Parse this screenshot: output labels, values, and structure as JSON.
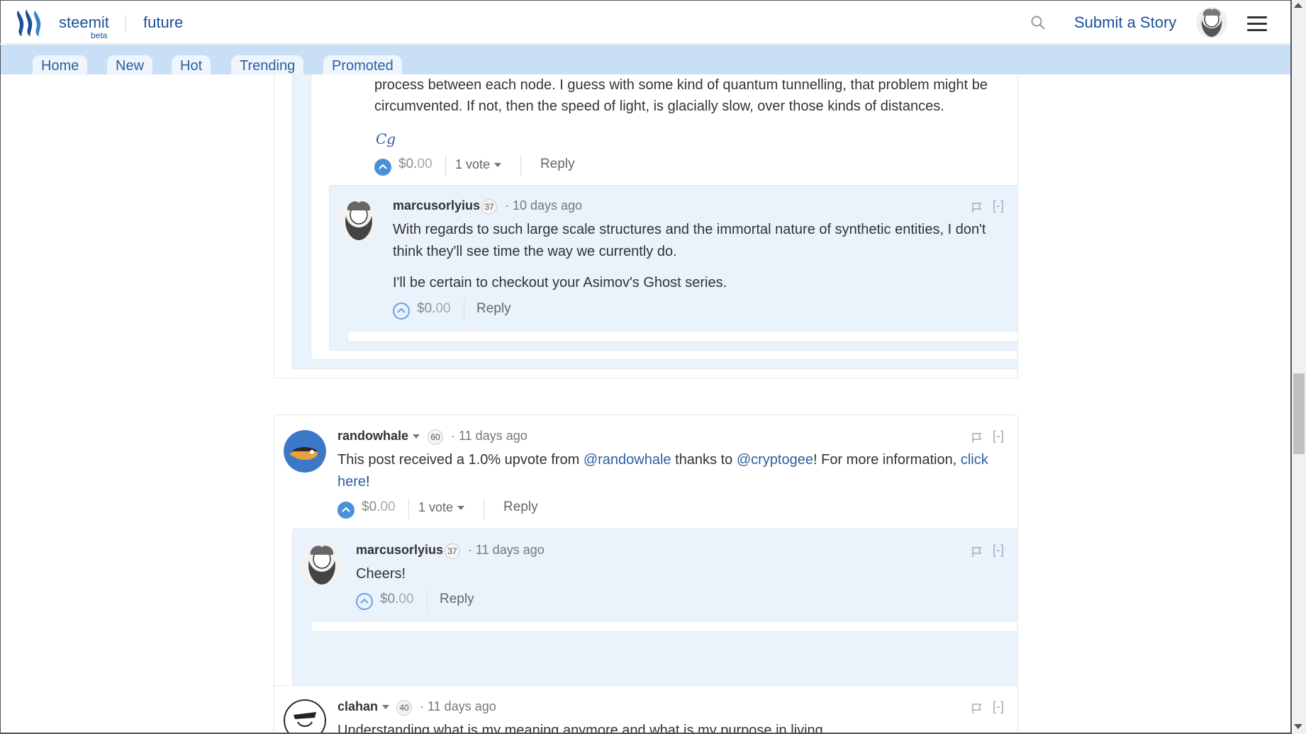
{
  "header": {
    "brand": "steemit",
    "brand_sub": "beta",
    "section": "future",
    "submit_label": "Submit a Story"
  },
  "nav": {
    "tabs": [
      "Home",
      "New",
      "Hot",
      "Trending",
      "Promoted"
    ]
  },
  "thread1": {
    "parent_text_line1": "process between each node. I guess with some kind of quantum tunnelling, that problem might be",
    "parent_text_line2": "circumvented. If not, then the speed of light, is glacially slow, over those kinds of distances.",
    "parent_signature": "Cg",
    "parent_payout_main": "$0.",
    "parent_payout_cents": "00",
    "parent_votes": "1 vote",
    "parent_reply": "Reply",
    "reply": {
      "author": "marcusorlyius",
      "rep": "37",
      "time": "· 10 days ago",
      "collapse": "[-]",
      "text_line1": "With regards to such large scale structures and the immortal nature of synthetic entities, I don't",
      "text_line2": "think they'll see time the way we currently do.",
      "text_line3": "I'll be certain to checkout your Asimov's Ghost series.",
      "payout_main": "$0.",
      "payout_cents": "00",
      "reply_label": "Reply"
    }
  },
  "thread2": {
    "author": "randowhale",
    "rep": "60",
    "time": "· 11 days ago",
    "collapse": "[-]",
    "text_a": "This post received a 1.0% upvote from ",
    "link_a": "@randowhale",
    "text_b": " thanks to ",
    "link_b": "@cryptogee",
    "text_c": "! For more information, ",
    "link_c1": "click",
    "link_c2": "here",
    "text_d": "!",
    "payout_main": "$0.",
    "payout_cents": "00",
    "votes": "1 vote",
    "reply_label": "Reply",
    "reply": {
      "author": "marcusorlyius",
      "rep": "37",
      "time": "· 11 days ago",
      "collapse": "[-]",
      "text": "Cheers!",
      "payout_main": "$0.",
      "payout_cents": "00",
      "reply_label": "Reply"
    }
  },
  "thread3": {
    "author": "clahan",
    "rep": "40",
    "time": "· 11 days ago",
    "collapse": "[-]",
    "text": "Understanding what is my meaning anymore and what is my purpose in living."
  },
  "colors": {
    "brand_blue": "#1a5099",
    "nav_bg": "#c9dff5",
    "nested_bg": "#eaf2fb",
    "upvote_blue": "#4a90d9",
    "link_blue": "#2c5fa0"
  }
}
